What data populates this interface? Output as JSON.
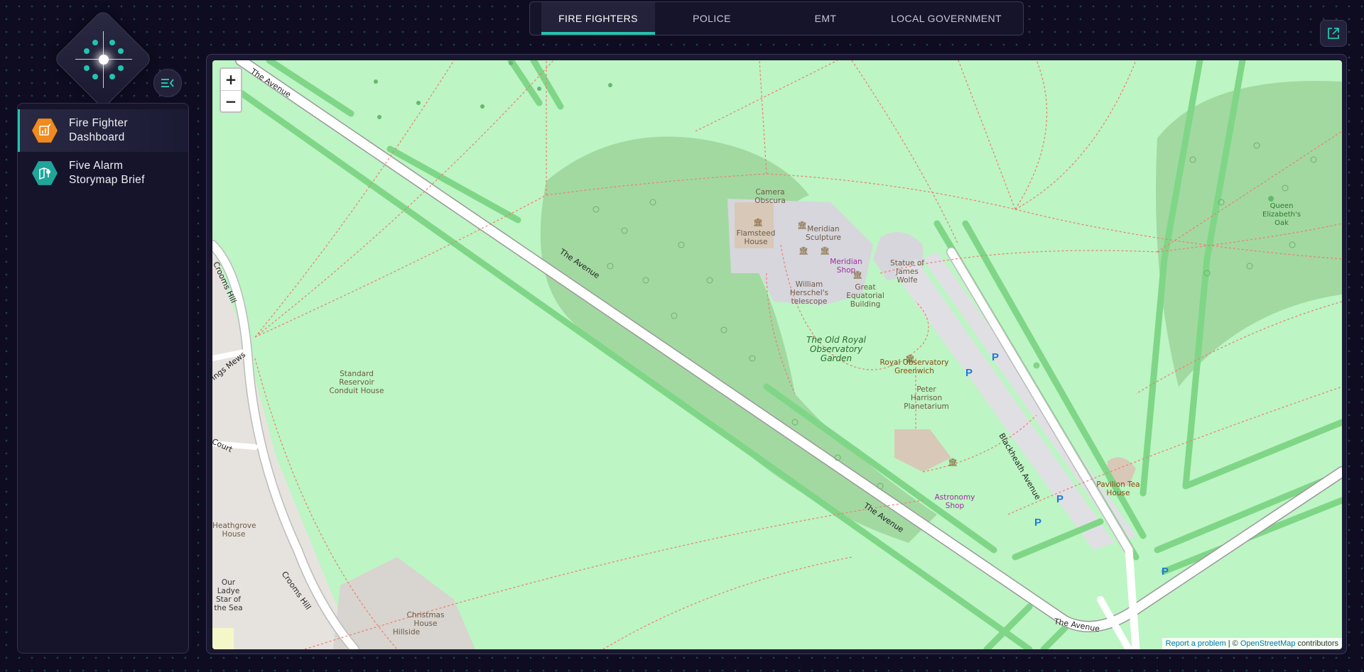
{
  "colors": {
    "accent": "#22c3b0",
    "background": "#0f0c22",
    "panel": "#16142b",
    "fire_icon": "#f08a1c",
    "storymap_icon": "#1fa59a"
  },
  "tabs": [
    {
      "label": "FIRE FIGHTERS",
      "active": true
    },
    {
      "label": "POLICE",
      "active": false
    },
    {
      "label": "EMT",
      "active": false
    },
    {
      "label": "LOCAL GOVERNMENT",
      "active": false
    }
  ],
  "sidebar": {
    "items": [
      {
        "label": "Fire Fighter Dashboard",
        "icon": "dashboard-icon",
        "active": true
      },
      {
        "label": "Five Alarm Storymap Brief",
        "icon": "storymap-icon",
        "active": false
      }
    ]
  },
  "map": {
    "zoom_in": "+",
    "zoom_out": "−",
    "attribution": {
      "report": "Report a problem",
      "separator": " | © ",
      "osm": "OpenStreetMap",
      "suffix": " contributors"
    },
    "labels": {
      "the_avenue": "The Avenue",
      "crooms_hill": "Crooms Hill",
      "kings_mews": "ings Mews",
      "court": "Court",
      "blackheath_avenue": "Blackheath Avenue",
      "standard_reservoir": "Standard Reservoir Conduit House",
      "camera_obscura": "Camera Obscura",
      "flamsteed_house": "Flamsteed House",
      "meridian_sculpture": "Meridian Sculpture",
      "meridian_shop": "Meridian Shop",
      "william_herschel": "William Herschel's telescope",
      "great_equatorial": "Great Equatorial Building",
      "statue_wolfe": "Statue of James Wolfe",
      "old_royal_garden": "The Old Royal Observatory Garden",
      "royal_observatory": "Royal Observatory Greenwich",
      "peter_harrison": "Peter Harrison Planetarium",
      "astronomy_shop": "Astronomy Shop",
      "pavilion_tea": "Pavilion Tea House",
      "queen_elizabeth_oak": "Queen Elizabeth's Oak",
      "heathgrove_house": "Heathgrove House",
      "our_lady": "Our Ladye Star of the Sea",
      "christmas_house": "Christmas House",
      "hillside": "Hillside",
      "parking": "P"
    }
  }
}
